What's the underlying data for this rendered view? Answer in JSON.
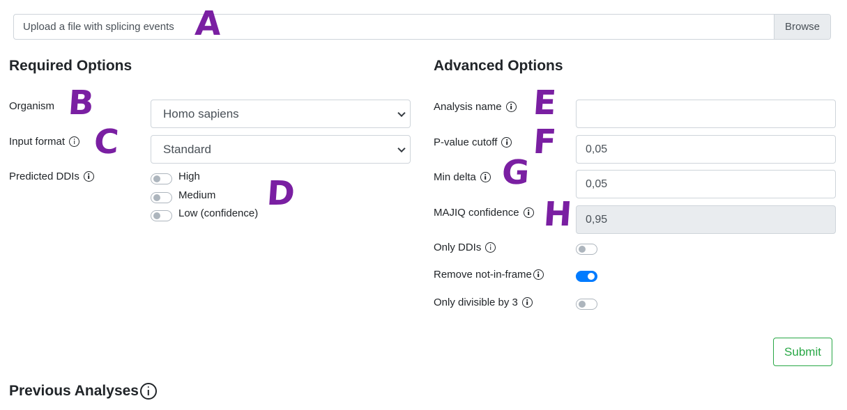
{
  "upload": {
    "placeholder": "Upload a file with splicing events",
    "browse_label": "Browse"
  },
  "required": {
    "title": "Required Options",
    "organism": {
      "label": "Organism",
      "value": "Homo sapiens"
    },
    "input_format": {
      "label": "Input format",
      "value": "Standard"
    },
    "predicted_ddis": {
      "label": "Predicted DDIs",
      "options": [
        {
          "label": "High",
          "on": false
        },
        {
          "label": "Medium",
          "on": false
        },
        {
          "label": "Low (confidence)",
          "on": false
        }
      ]
    }
  },
  "advanced": {
    "title": "Advanced Options",
    "analysis_name": {
      "label": "Analysis name",
      "value": ""
    },
    "pvalue_cutoff": {
      "label": "P-value cutoff",
      "value": "0,05"
    },
    "min_delta": {
      "label": "Min delta",
      "value": "0,05"
    },
    "majiq_confidence": {
      "label": "MAJIQ confidence",
      "value": "0,95",
      "disabled": true
    },
    "only_ddis": {
      "label": "Only DDIs",
      "on": false
    },
    "remove_not_in_frame": {
      "label": "Remove not-in-frame",
      "on": true
    },
    "only_divisible_by_3": {
      "label": "Only divisible by 3",
      "on": false
    }
  },
  "submit_label": "Submit",
  "previous": {
    "title": "Previous Analyses"
  },
  "annotations": [
    "A",
    "B",
    "C",
    "D",
    "E",
    "F",
    "G",
    "H"
  ],
  "colors": {
    "accent": "#007bff",
    "submit": "#28a745",
    "annotation": "#7a1fa2"
  }
}
